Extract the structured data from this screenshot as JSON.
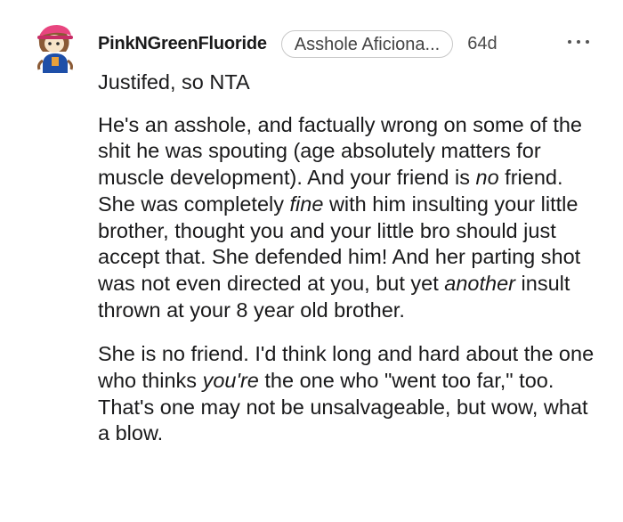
{
  "comment": {
    "username": "PinkNGreenFluoride",
    "flair": "Asshole Aficiona...",
    "age": "64d",
    "avatar_icon": "avatar-icon",
    "more_icon": "more-options-icon",
    "paragraphs": {
      "p1": "Justifed, so NTA",
      "p2": {
        "a": "He's an asshole, and factually wrong on some of the shit he was spouting (age absolutely matters for muscle development). And your friend is ",
        "b": "no",
        "c": " friend. She was completely ",
        "d": "fine",
        "e": " with him insulting your little brother, thought you and your little bro should just accept that. She defended him! And her parting shot was not even directed at you, but yet ",
        "f": "another",
        "g": " insult thrown at your 8 year old brother."
      },
      "p3": {
        "a": "She is no friend. I'd think long and hard about the one who thinks ",
        "b": "you're",
        "c": " the one who \"went too far,\" too. That's one may not be unsalvageable, but wow, what a blow."
      }
    }
  }
}
